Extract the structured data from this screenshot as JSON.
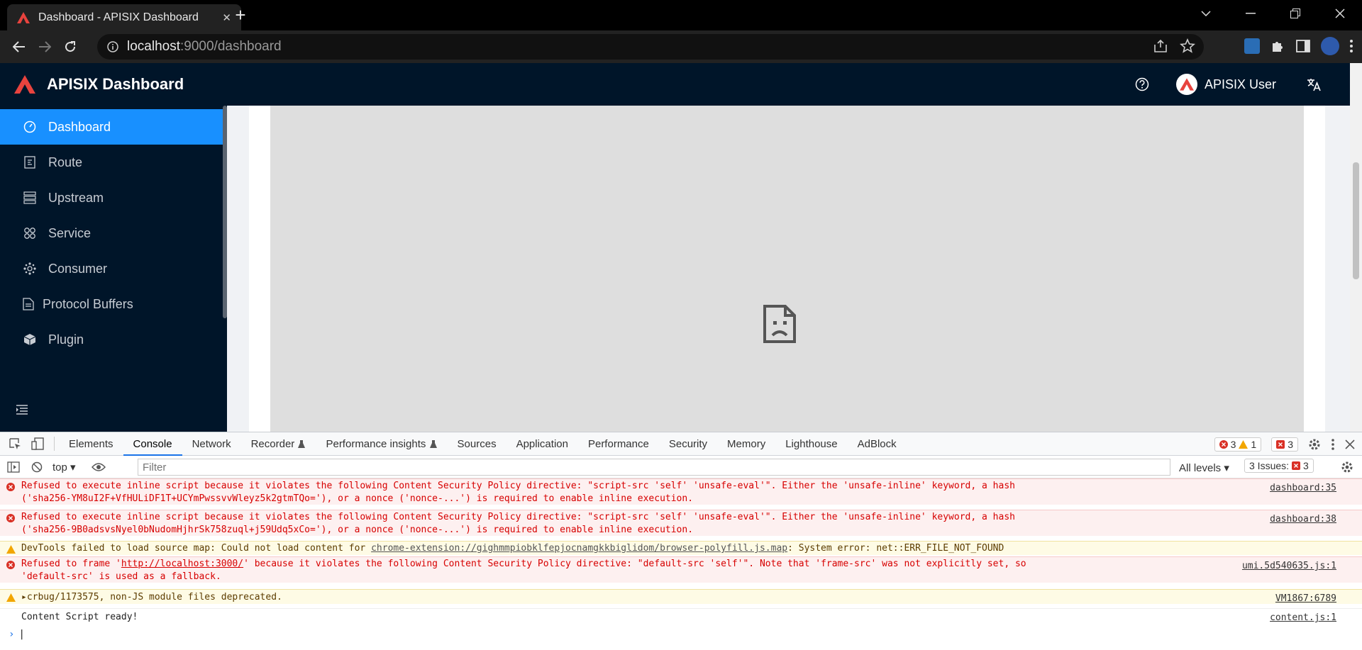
{
  "browser": {
    "tab_title": "Dashboard - APISIX Dashboard",
    "tab_close": "✕",
    "new_tab": "+",
    "url_host": "localhost",
    "url_path": ":9000/dashboard"
  },
  "app": {
    "brand": "APISIX Dashboard",
    "user_name": "APISIX User",
    "brand_color": "#001529",
    "accent": "#1890ff"
  },
  "sidebar": {
    "items": [
      {
        "label": "Dashboard",
        "icon": "dashboard-icon"
      },
      {
        "label": "Route",
        "icon": "route-icon"
      },
      {
        "label": "Upstream",
        "icon": "upstream-icon"
      },
      {
        "label": "Service",
        "icon": "service-icon"
      },
      {
        "label": "Consumer",
        "icon": "consumer-icon"
      },
      {
        "label": "Protocol Buffers",
        "icon": "file-icon"
      },
      {
        "label": "Plugin",
        "icon": "plugin-icon"
      }
    ]
  },
  "devtools": {
    "tabs": [
      "Elements",
      "Console",
      "Network",
      "Recorder",
      "Performance insights",
      "Sources",
      "Application",
      "Performance",
      "Security",
      "Memory",
      "Lighthouse",
      "AdBlock"
    ],
    "error_count": "3",
    "warning_count": "1",
    "issue_badge_count": "3",
    "context": "top",
    "filter_placeholder": "Filter",
    "levels": "All levels",
    "issues_label": "3 Issues:",
    "issues_count": "3",
    "messages": [
      {
        "level": "error",
        "text": "Refused to execute inline script because it violates the following Content Security Policy directive: \"script-src 'self' 'unsafe-eval'\". Either the 'unsafe-inline' keyword, a hash ('sha256-YM8uI2F+VfHULiDF1T+UCYmPwssvvWleyz5k2gtmTQo='), or a nonce ('nonce-...') is required to enable inline execution.",
        "source": "dashboard:35"
      },
      {
        "level": "error",
        "text": "Refused to execute inline script because it violates the following Content Security Policy directive: \"script-src 'self' 'unsafe-eval'\". Either the 'unsafe-inline' keyword, a hash ('sha256-9B0adsvsNyel0bNudomHjhrSk758zuql+j59Udq5xCo='), or a nonce ('nonce-...') is required to enable inline execution.",
        "source": "dashboard:38"
      },
      {
        "level": "warning",
        "prefix": "DevTools failed to load source map: Could not load content for ",
        "link": "chrome-extension://gighmmpiobklfepjocnamgkkbiglidom/browser-polyfill.js.map",
        "suffix": ": System error: net::ERR_FILE_NOT_FOUND",
        "source": ""
      },
      {
        "level": "error",
        "prefix": "Refused to frame '",
        "link": "http://localhost:3000/",
        "suffix": "' because it violates the following Content Security Policy directive: \"default-src 'self'\". Note that 'frame-src' was not explicitly set, so 'default-src' is used as a fallback.",
        "source": "umi.5d540635.js:1"
      },
      {
        "level": "warning",
        "text": "crbug/1173575, non-JS module files deprecated.",
        "source": "VM1867:6789"
      },
      {
        "level": "log",
        "text": "Content Script ready!",
        "source": "content.js:1"
      }
    ]
  }
}
